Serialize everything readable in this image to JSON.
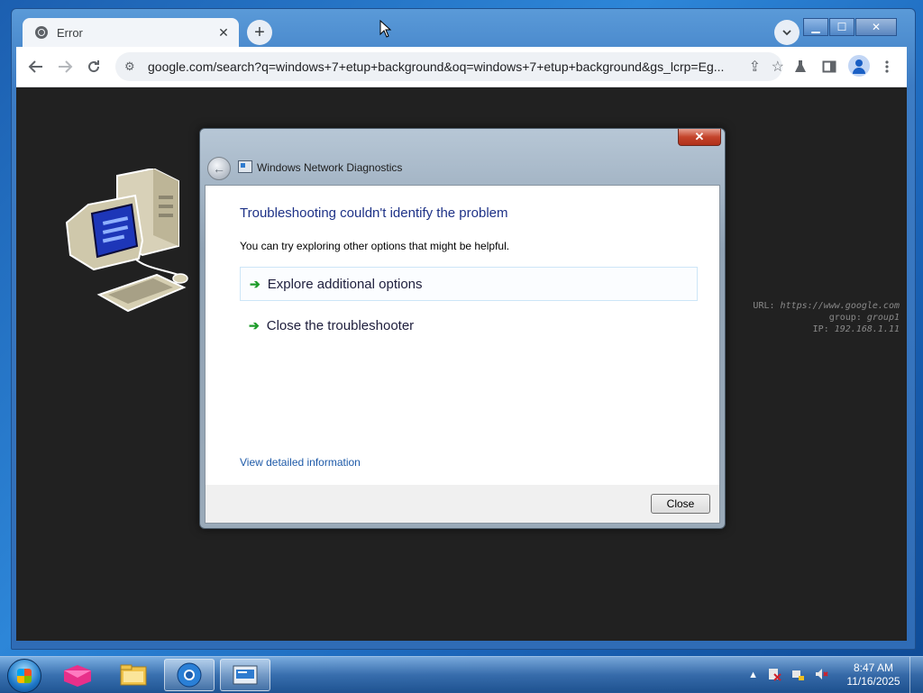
{
  "browser": {
    "tab_title": "Error",
    "tab_close": "✕",
    "new_tab": "+",
    "tab_search": "⌄",
    "url": "google.com/search?q=windows+7+etup+background&oq=windows+7+etup+background&gs_lcrp=Eg...",
    "caption": {
      "minimize": "▁",
      "maximize": "☐",
      "close": "✕"
    }
  },
  "page_overlay": {
    "url_label": "URL:",
    "url_value": "https://www.google.com",
    "group_label": "group:",
    "group_value": "group1",
    "ip_label": "IP:",
    "ip_value": "192.168.1.11"
  },
  "dialog": {
    "title": "Windows Network Diagnostics",
    "heading": "Troubleshooting couldn't identify the problem",
    "subtext": "You can try exploring other options that might be helpful.",
    "options": [
      {
        "label": "Explore additional options"
      },
      {
        "label": "Close the troubleshooter"
      }
    ],
    "link": "View detailed information",
    "close_button": "Close",
    "titlebar_close": "✕"
  },
  "taskbar": {
    "time": "8:47 AM",
    "date": "11/16/2025",
    "tray_chevron": "▲"
  }
}
